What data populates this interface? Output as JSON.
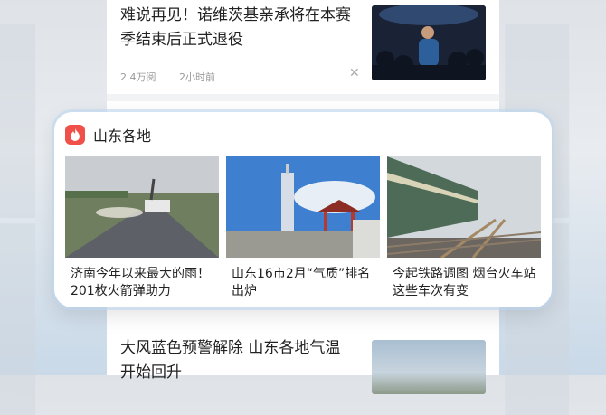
{
  "top_article": {
    "title": "难说再见！诺维茨基亲承将在本赛季结束后正式退役",
    "views": "2.4万阅",
    "time": "2小时前"
  },
  "popup": {
    "title": "山东各地",
    "items": [
      {
        "caption": "济南今年以来最大的雨！201枚火箭弹助力"
      },
      {
        "caption": "山东16市2月“气质”排名出炉"
      },
      {
        "caption": "今起铁路调图 烟台火车站这些车次有变"
      }
    ]
  },
  "bottom_article": {
    "title": "大风蓝色预警解除 山东各地气温开始回升"
  },
  "colors": {
    "accent_red": "#f0504a",
    "meta_gray": "#999999"
  }
}
